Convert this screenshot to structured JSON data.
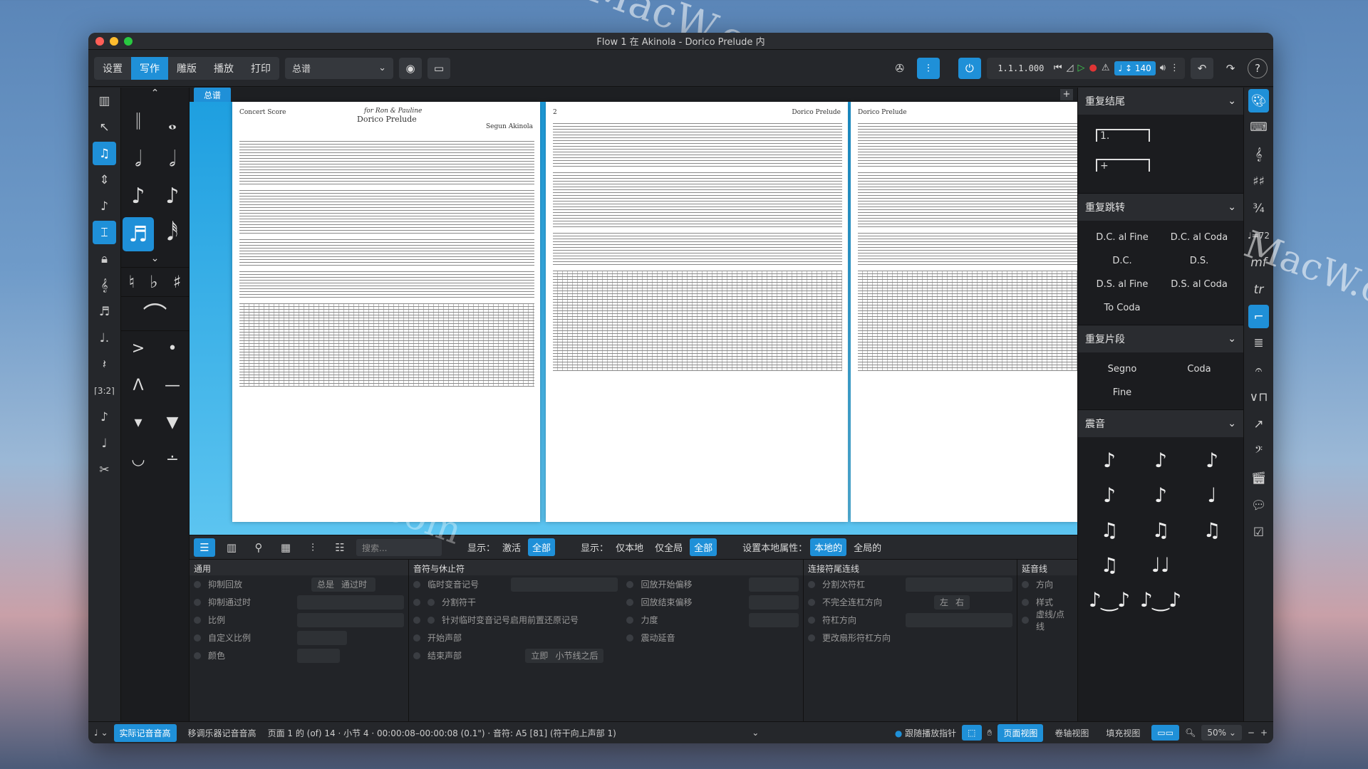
{
  "window": {
    "title": "Flow 1 在 Akinola - Dorico Prelude 内"
  },
  "toolbar": {
    "modes": [
      "设置",
      "写作",
      "雕版",
      "播放",
      "打印"
    ],
    "active_mode": "写作",
    "layout_select": "总谱",
    "time": "1.1.1.000",
    "tempo": "140"
  },
  "document": {
    "tab": "总谱",
    "page1": {
      "header_left": "Concert Score",
      "dedication": "for Ron & Pauline",
      "title": "Dorico Prelude",
      "composer": "Segun Akinola"
    },
    "page2": {
      "number": "2",
      "header": "Dorico Prelude"
    },
    "page3": {
      "header": "Dorico Prelude"
    }
  },
  "right_panel": {
    "sections": [
      {
        "title": "重复结尾",
        "items": []
      },
      {
        "title": "重复跳转",
        "items": [
          "D.C. al Fine",
          "D.C. al Coda",
          "D.C.",
          "D.S.",
          "D.S. al Fine",
          "D.S. al Coda",
          "To Coda"
        ]
      },
      {
        "title": "重复片段",
        "items": [
          "Segno",
          "Coda",
          "Fine"
        ]
      },
      {
        "title": "震音",
        "items": []
      }
    ]
  },
  "bottom_panel": {
    "search_placeholder": "搜索...",
    "show_label_1": "显示：",
    "show_opts_1": [
      "激活",
      "全部"
    ],
    "show_label_2": "显示：",
    "show_opts_2": [
      "仅本地",
      "仅全局",
      "全部"
    ],
    "local_label": "设置本地属性：",
    "local_opts": [
      "本地的",
      "全局的"
    ],
    "groups": [
      {
        "title": "通用",
        "rows": [
          "抑制回放",
          "抑制通过时",
          "比例",
          "自定义比例",
          "颜色"
        ],
        "field_values": [
          "总是",
          "通过时"
        ]
      },
      {
        "title": "音符与休止符",
        "rows": [
          "临时变音记号",
          "分割符干",
          "针对临时变音记号启用前置还原记号",
          "开始声部",
          "结束声部"
        ],
        "field_values": [
          "立即",
          "小节线之后"
        ]
      },
      {
        "title": "",
        "rows": [
          "回放开始偏移",
          "回放结束偏移",
          "力度",
          "震动延音"
        ]
      },
      {
        "title": "连接符尾连线",
        "rows": [
          "分割次符杠",
          "不完全连杠方向",
          "符杠方向",
          "更改扇形符杠方向"
        ],
        "field_values": [
          "左",
          "右"
        ]
      },
      {
        "title": "延音线",
        "rows": [
          "方向",
          "样式",
          "虚线/点线"
        ]
      }
    ]
  },
  "status_bar": {
    "concert_pitch": "实际记音音高",
    "transposed": "移调乐器记音音高",
    "info": "页面 1 的 (of) 14 · 小节 4 · 00:00:08–00:00:08 (0.1\") · 音符: A5 [81] (符干向上声部 1)",
    "follow": "跟随播放指针",
    "views": [
      "页面视图",
      "卷轴视图",
      "填充视图"
    ],
    "zoom": "50%"
  },
  "watermark": "MacW.com",
  "colors": {
    "accent": "#1f90d8",
    "bg": "#1f2124"
  }
}
